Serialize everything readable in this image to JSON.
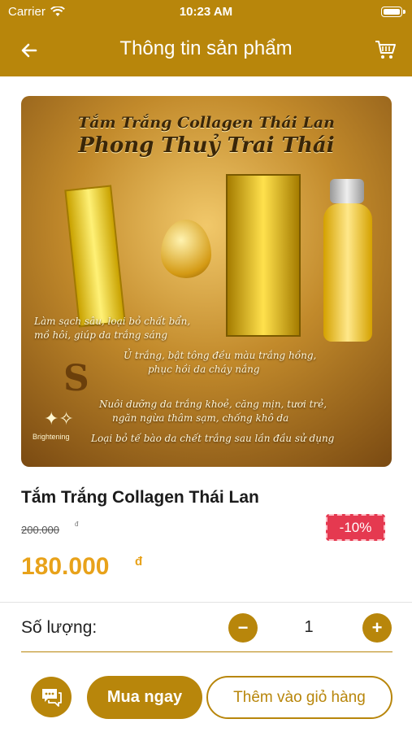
{
  "status_bar": {
    "carrier": "Carrier",
    "time": "10:23 AM"
  },
  "header": {
    "title": "Thông tin sản phẩm"
  },
  "hero": {
    "title_line1": "Tắm Trắng Collagen Thái Lan",
    "title_line2": "Phong Thuỷ Trai Thái",
    "letter": "S",
    "badge_word": "Brightening",
    "benefit_lines": [
      "Làm sạch sâu, loại bỏ chất bẩn,",
      "mồ hôi, giúp da trắng sáng",
      "Ủ trắng, bật tông đều màu trắng hồng,",
      "phục hồi da cháy nắng",
      "Nuôi dưỡng da trắng khoẻ, căng mịn, tươi trẻ,",
      "ngăn ngừa thâm sạm, chống khô da",
      "Loại bỏ tế bào da chết trắng sau lần đầu sử dụng"
    ]
  },
  "product": {
    "name": "Tắm Trắng Collagen Thái Lan",
    "old_price": "200.000",
    "old_currency": "đ",
    "discount": "-10%",
    "price": "180.000",
    "currency": "đ"
  },
  "quantity": {
    "label": "Số lượng:",
    "value": "1",
    "minus": "−",
    "plus": "+"
  },
  "actions": {
    "buy_now": "Mua ngay",
    "add_to_cart": "Thêm vào giỏ hàng"
  },
  "colors": {
    "primary": "#b8860b",
    "price": "#e8a21a",
    "discount": "#e53950"
  }
}
